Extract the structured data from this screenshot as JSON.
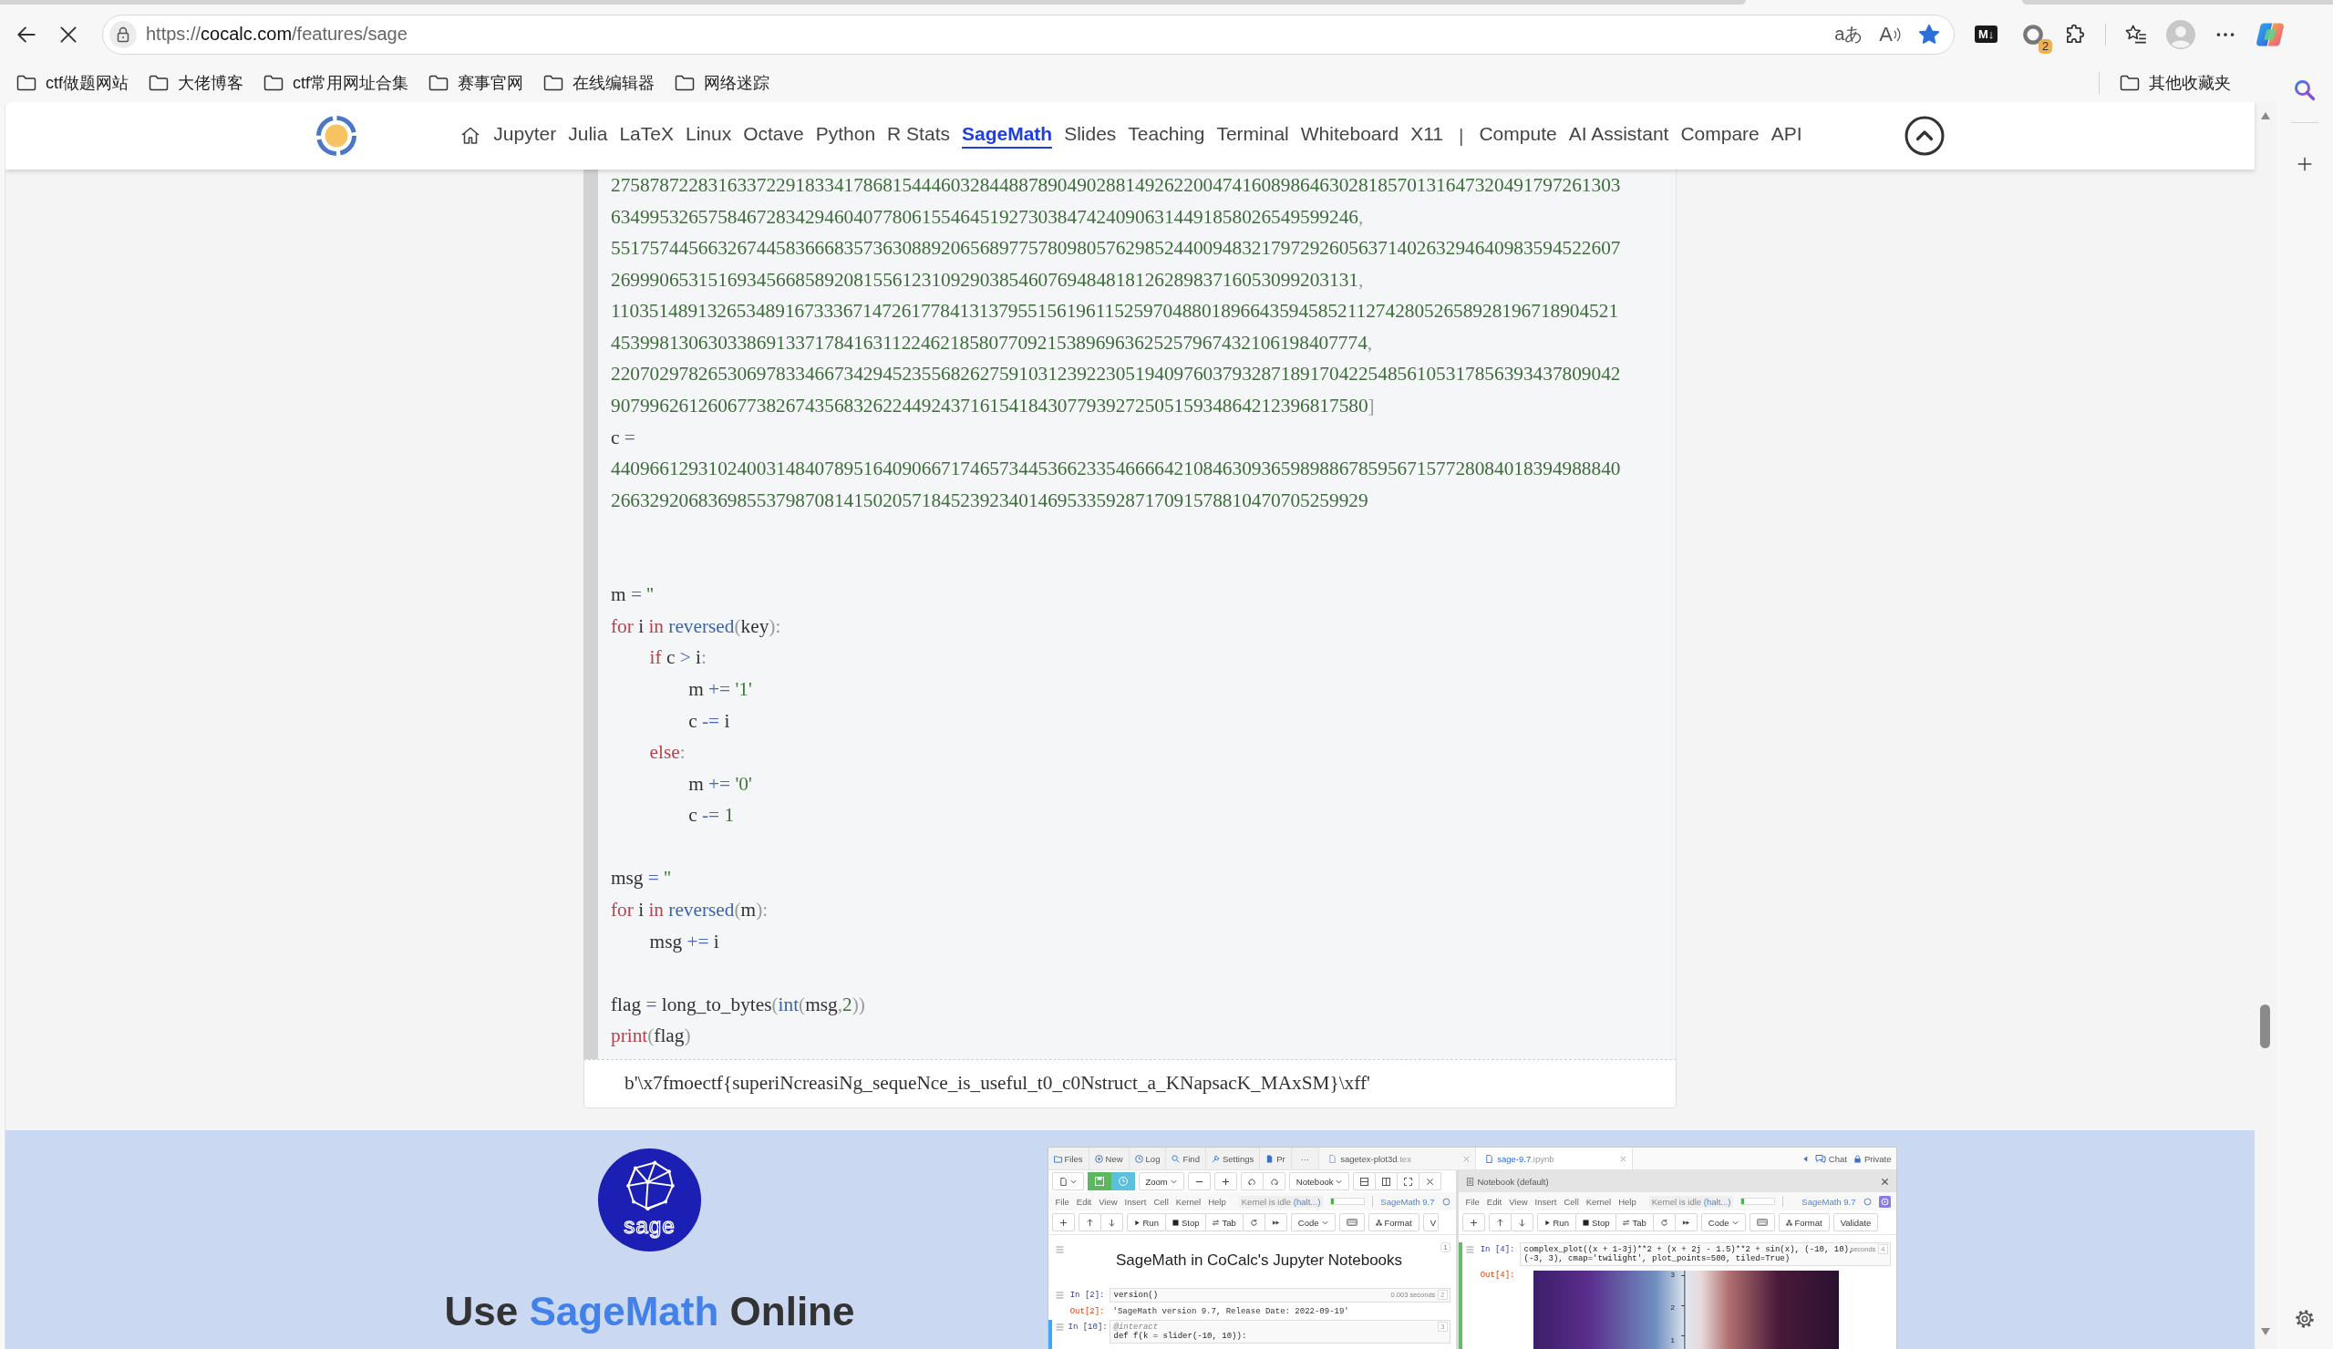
{
  "browser": {
    "loading": true,
    "url": {
      "scheme": "https://",
      "host": "cocalc.com",
      "path": "/features/sage"
    },
    "translate_glyph": "aあ",
    "read_aloud_glyph": "A",
    "favorited": true,
    "markdown_glyph": "M↓",
    "extension_badge": "2",
    "bookmarks": [
      {
        "label": "ctf做题网站"
      },
      {
        "label": "大佬博客"
      },
      {
        "label": "ctf常用网址合集"
      },
      {
        "label": "赛事官网"
      },
      {
        "label": "在线编辑器"
      },
      {
        "label": "网络迷踪"
      }
    ],
    "other_bookmarks": "其他收藏夹"
  },
  "nav": {
    "links": [
      {
        "label": "Jupyter",
        "selected": false
      },
      {
        "label": "Julia",
        "selected": false
      },
      {
        "label": "LaTeX",
        "selected": false
      },
      {
        "label": "Linux",
        "selected": false
      },
      {
        "label": "Octave",
        "selected": false
      },
      {
        "label": "Python",
        "selected": false
      },
      {
        "label": "R Stats",
        "selected": false
      },
      {
        "label": "SageMath",
        "selected": true
      },
      {
        "label": "Slides",
        "selected": false
      },
      {
        "label": "Teaching",
        "selected": false
      },
      {
        "label": "Terminal",
        "selected": false
      },
      {
        "label": "Whiteboard",
        "selected": false
      },
      {
        "label": "X11",
        "selected": false
      }
    ],
    "separator": "|",
    "more_links": [
      {
        "label": "Compute",
        "selected": false
      },
      {
        "label": "AI Assistant",
        "selected": false
      },
      {
        "label": "Compare",
        "selected": false
      },
      {
        "label": "API",
        "selected": false
      }
    ]
  },
  "code": {
    "lines": [
      {
        "kind": "code",
        "tokens": [
          {
            "kind": "number",
            "text": "27587872283163372291833417868154446032844887890490288149262200474160898646302818570131647320491797261303"
          }
        ]
      },
      {
        "kind": "code",
        "tokens": [
          {
            "kind": "number",
            "text": "63499532657584672834294604077806155464519273038474240906314491858026549599246"
          },
          {
            "kind": "punct",
            "text": ","
          }
        ]
      },
      {
        "kind": "code",
        "tokens": [
          {
            "kind": "number",
            "text": "55175744566326744583666835736308892065689775780980576298524400948321797292605637140263294640983594522607"
          }
        ]
      },
      {
        "kind": "code",
        "tokens": [
          {
            "kind": "number",
            "text": "26999065315169345668589208155612310929038546076948481812628983716053099203131"
          },
          {
            "kind": "punct",
            "text": ","
          }
        ]
      },
      {
        "kind": "code",
        "tokens": [
          {
            "kind": "number",
            "text": "11035148913265348916733367147261778413137955156196115259704880189664359458521127428052658928196718904521"
          }
        ]
      },
      {
        "kind": "code",
        "tokens": [
          {
            "kind": "number",
            "text": "453998130630338691337178416311224621858077092153896963625257967432106198407774"
          },
          {
            "kind": "punct",
            "text": ","
          }
        ]
      },
      {
        "kind": "code",
        "tokens": [
          {
            "kind": "number",
            "text": "22070297826530697833466734294523556826275910312392230519409760379328718917042254856105317856393437809042"
          }
        ]
      },
      {
        "kind": "code",
        "tokens": [
          {
            "kind": "number",
            "text": "907996261260677382674356832622449243716154184307793927250515934864212396817580"
          },
          {
            "kind": "punct",
            "text": "]"
          }
        ]
      },
      {
        "kind": "code",
        "tokens": [
          {
            "kind": "name",
            "text": "c "
          },
          {
            "kind": "operator",
            "text": "="
          }
        ]
      },
      {
        "kind": "code",
        "tokens": [
          {
            "kind": "number",
            "text": "44096612931024003148407895164090667174657344536623354666642108463093659898867859567157728084018394988840"
          }
        ]
      },
      {
        "kind": "code",
        "tokens": [
          {
            "kind": "number",
            "text": "266329206836985537987081415020571845239234014695335928717091578810470705259929"
          }
        ]
      },
      {
        "kind": "blank"
      },
      {
        "kind": "blank"
      },
      {
        "kind": "code",
        "tokens": [
          {
            "kind": "name",
            "text": "m "
          },
          {
            "kind": "operator",
            "text": "="
          },
          {
            "kind": "string",
            "text": " ''"
          }
        ]
      },
      {
        "kind": "code",
        "tokens": [
          {
            "kind": "keyword",
            "text": "for"
          },
          {
            "kind": "name",
            "text": " i "
          },
          {
            "kind": "keyword",
            "text": "in"
          },
          {
            "kind": "builtin",
            "text": " reversed"
          },
          {
            "kind": "punct",
            "text": "("
          },
          {
            "kind": "name",
            "text": "key"
          },
          {
            "kind": "punct",
            "text": "):"
          }
        ],
        "children": [
          {
            "kind": "code",
            "tokens": [
              {
                "kind": "keyword",
                "text": "if"
              },
              {
                "kind": "name",
                "text": " c "
              },
              {
                "kind": "operator",
                "text": ">"
              },
              {
                "kind": "name",
                "text": " i"
              },
              {
                "kind": "punct",
                "text": ":"
              }
            ],
            "children": [
              {
                "kind": "code",
                "tokens": [
                  {
                    "kind": "name",
                    "text": "m "
                  },
                  {
                    "kind": "operator",
                    "text": "+="
                  },
                  {
                    "kind": "string",
                    "text": " '1'"
                  }
                ]
              },
              {
                "kind": "code",
                "tokens": [
                  {
                    "kind": "name",
                    "text": "c "
                  },
                  {
                    "kind": "operator",
                    "text": "-="
                  },
                  {
                    "kind": "name",
                    "text": " i"
                  }
                ]
              }
            ]
          },
          {
            "kind": "code",
            "tokens": [
              {
                "kind": "keyword",
                "text": "else"
              },
              {
                "kind": "punct",
                "text": ":"
              }
            ],
            "children": [
              {
                "kind": "code",
                "tokens": [
                  {
                    "kind": "name",
                    "text": "m "
                  },
                  {
                    "kind": "operator",
                    "text": "+="
                  },
                  {
                    "kind": "string",
                    "text": " '0'"
                  }
                ]
              },
              {
                "kind": "code",
                "tokens": [
                  {
                    "kind": "name",
                    "text": "c "
                  },
                  {
                    "kind": "operator",
                    "text": "-="
                  },
                  {
                    "kind": "number",
                    "text": " 1"
                  }
                ]
              }
            ]
          }
        ]
      },
      {
        "kind": "blank"
      },
      {
        "kind": "code",
        "tokens": [
          {
            "kind": "name",
            "text": "msg "
          },
          {
            "kind": "operator",
            "text": "="
          },
          {
            "kind": "string",
            "text": " ''"
          }
        ]
      },
      {
        "kind": "code",
        "tokens": [
          {
            "kind": "keyword",
            "text": "for"
          },
          {
            "kind": "name",
            "text": " i "
          },
          {
            "kind": "keyword",
            "text": "in"
          },
          {
            "kind": "builtin",
            "text": " reversed"
          },
          {
            "kind": "punct",
            "text": "("
          },
          {
            "kind": "name",
            "text": "m"
          },
          {
            "kind": "punct",
            "text": "):"
          }
        ],
        "children": [
          {
            "kind": "code",
            "tokens": [
              {
                "kind": "name",
                "text": "msg "
              },
              {
                "kind": "operator",
                "text": "+="
              },
              {
                "kind": "name",
                "text": " i"
              }
            ]
          }
        ]
      },
      {
        "kind": "blank"
      },
      {
        "kind": "code",
        "tokens": [
          {
            "kind": "name",
            "text": "flag "
          },
          {
            "kind": "operator",
            "text": "="
          },
          {
            "kind": "name",
            "text": " long_to_bytes"
          },
          {
            "kind": "punct",
            "text": "("
          },
          {
            "kind": "builtin",
            "text": "int"
          },
          {
            "kind": "punct",
            "text": "("
          },
          {
            "kind": "name",
            "text": "msg"
          },
          {
            "kind": "punct",
            "text": ","
          },
          {
            "kind": "number",
            "text": "2"
          },
          {
            "kind": "punct",
            "text": "))"
          }
        ]
      },
      {
        "kind": "code",
        "tokens": [
          {
            "kind": "keyword",
            "text": "print"
          },
          {
            "kind": "punct",
            "text": "("
          },
          {
            "kind": "name",
            "text": "flag"
          },
          {
            "kind": "punct",
            "text": ")"
          }
        ]
      }
    ],
    "output": "b'\\x7fmoectf{superiNcreasiNg_sequeNce_is_useful_t0_c0Nstruct_a_KNapsacK_MAxSM}\\xff'"
  },
  "banner": {
    "logo_text": "sage",
    "heading": [
      {
        "text": "Use ",
        "highlight": false
      },
      {
        "text": "SageMath",
        "highlight": true
      },
      {
        "text": " Online",
        "highlight": false
      }
    ],
    "screenshot": {
      "top_buttons": [
        {
          "label": "Files"
        },
        {
          "label": "New"
        },
        {
          "label": "Log"
        },
        {
          "label": "Find"
        },
        {
          "label": "Settings"
        },
        {
          "label": "Pr"
        }
      ],
      "more": "···",
      "file_tabs": [
        {
          "name": "sagetex-plot3d",
          "extension": ".tex",
          "selected": false
        },
        {
          "name": "sage-9.7",
          "extension": ".ipynb",
          "selected": true
        }
      ],
      "side_links": [
        {
          "label": "Chat"
        },
        {
          "label": "Private"
        }
      ],
      "left_pane": {
        "zoom": "Zoom",
        "view": "Notebook",
        "menu": [
          "File",
          "Edit",
          "View",
          "Insert",
          "Cell",
          "Kernel",
          "Help"
        ],
        "kernel_status": {
          "text": "Kernel is idle",
          "action": "(halt...)"
        },
        "kernel_usage": {
          "level": 0.06
        },
        "kernel_name": "SageMath 9.7",
        "actions": [
          "Run",
          "Stop",
          "Tab",
          "Code",
          "Format",
          "V"
        ],
        "cells": [
          {
            "kind": "markdown",
            "text": "SageMath in CoCalc's Jupyter Notebooks",
            "number": "1",
            "selected": false
          },
          {
            "kind": "code",
            "prompt": "In [2]:",
            "lines": [
              {
                "kind": "code",
                "text": "version()"
              }
            ],
            "timing": "0.003 seconds",
            "number": "2",
            "selected": false,
            "output_prompt": "Out[2]:",
            "output": "'SageMath version 9.7, Release Date: 2022-09-19'"
          },
          {
            "kind": "code",
            "prompt": "In [10]:",
            "lines": [
              {
                "kind": "decorator",
                "text": "@interact"
              },
              {
                "kind": "code",
                "text": "def f(k = slider(-10, 10)):"
              }
            ],
            "number": "3",
            "selected": true,
            "editing": false
          }
        ]
      },
      "right_pane": {
        "title": "Notebook (default)",
        "menu": [
          "File",
          "Edit",
          "View",
          "Insert",
          "Cell",
          "Kernel",
          "Help"
        ],
        "kernel_status": {
          "text": "Kernel is idle",
          "action": "(halt...)"
        },
        "kernel_usage": {
          "level": 0.06
        },
        "kernel_name": "SageMath 9.7",
        "actions": [
          "Run",
          "Stop",
          "Tab",
          "Code",
          "Format",
          "Validate"
        ],
        "cells": [
          {
            "kind": "code",
            "prompt": "In [4]:",
            "lines": [
              {
                "kind": "code",
                "text": "complex_plot((x + 1-3j)**2 + (x + 2j - 1.5)**2 + sin(x), (-10, 10),"
              },
              {
                "kind": "code",
                "text": "(-3, 3), cmap='twilight', plot_points=500, tiled=True)"
              }
            ],
            "timing": "seconds",
            "number": "4",
            "selected": true,
            "editing": true,
            "output_prompt": "Out[4]:",
            "plot_ticks": [
              "3",
              "2",
              "1"
            ]
          }
        ]
      }
    }
  }
}
